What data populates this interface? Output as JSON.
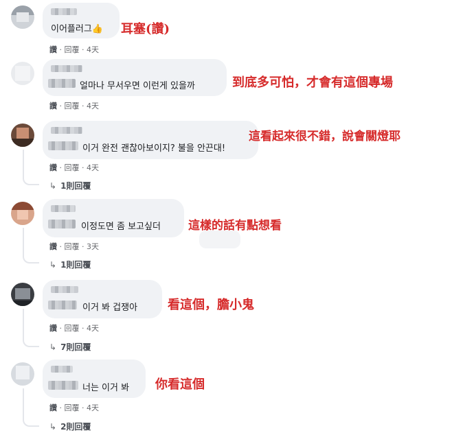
{
  "comments": [
    {
      "text": "이어플러그",
      "annotation": "耳塞(讚)",
      "meta": {
        "like": "讚",
        "reply": "回覆",
        "time": "4天"
      },
      "replies": ""
    },
    {
      "text": "얼마나 무서우면 이런게 있을까",
      "annotation": "到底多可怕，才會有這個專場",
      "meta": {
        "like": "讚",
        "reply": "回覆",
        "time": "4天"
      },
      "replies": ""
    },
    {
      "text": "이거 완전 괜찮아보이지? 불을 안끈대!",
      "annotation": "這看起來很不錯，說會關燈耶",
      "meta": {
        "like": "讚",
        "reply": "回覆",
        "time": "4天"
      },
      "replies": "1則回覆"
    },
    {
      "text": "이정도면 좀 보고싶더",
      "annotation": "這樣的話有點想看",
      "meta": {
        "like": "讚",
        "reply": "回覆",
        "time": "3天"
      },
      "replies": "1則回覆"
    },
    {
      "text": "이거 봐 겁쟁아",
      "annotation": "看這個，膽小鬼",
      "meta": {
        "like": "讚",
        "reply": "回覆",
        "time": "4天"
      },
      "replies": "7則回覆"
    },
    {
      "text": "너는 이거 봐",
      "annotation": "你看這個",
      "meta": {
        "like": "讚",
        "reply": "回覆",
        "time": "4天"
      },
      "replies": "2則回覆"
    }
  ],
  "glyphs": {
    "thumb": "👍",
    "meta_sep": " · ",
    "reply_arrow": "↳"
  },
  "colors": {
    "annotation": "#d62b2b",
    "bubble": "#f0f2f5",
    "meta": "#65676b"
  }
}
